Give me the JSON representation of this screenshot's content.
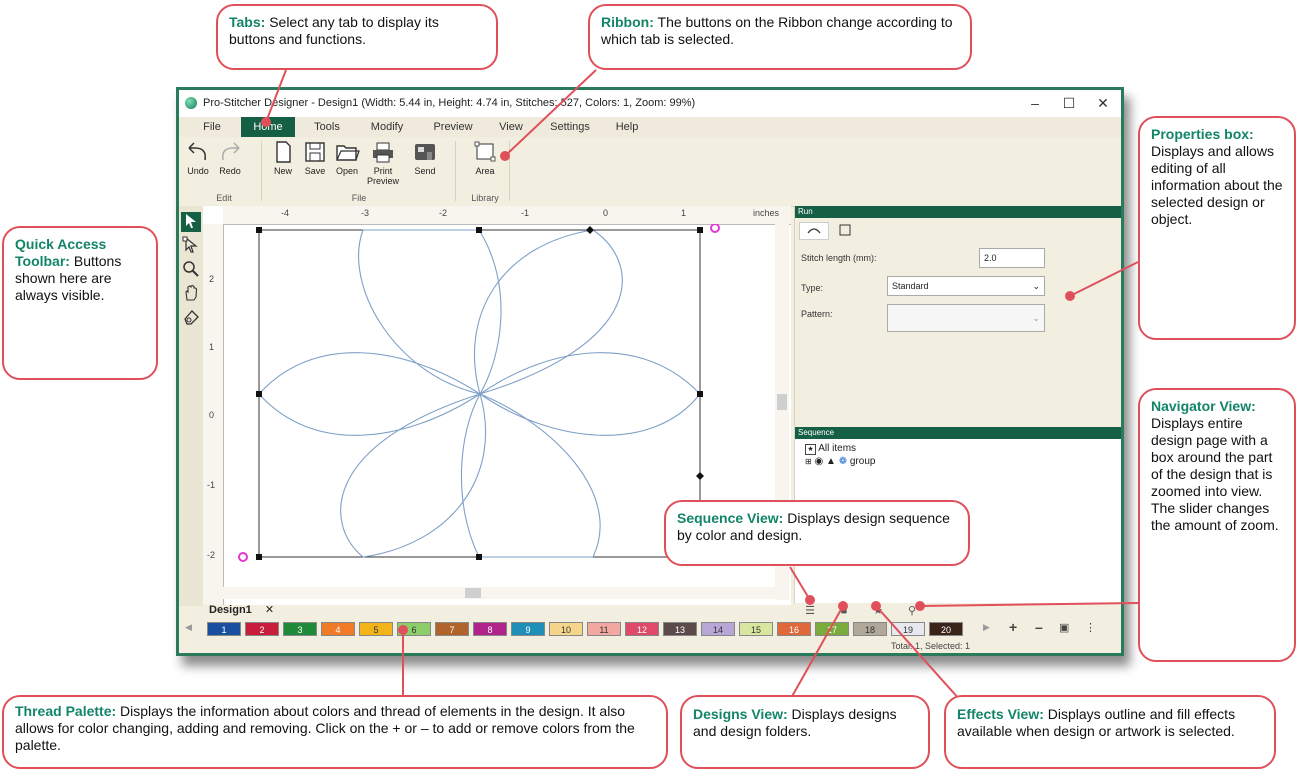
{
  "callouts": {
    "tabs": {
      "title": "Tabs:",
      "text": " Select any tab to display its buttons and functions."
    },
    "ribbon": {
      "title": "Ribbon:",
      "text": " The buttons on the Ribbon change according to which tab is selected."
    },
    "properties": {
      "title": "Properties box:",
      "text": " Displays and allows editing of all information about the selected design or object."
    },
    "qat": {
      "title": "Quick Access Toolbar:",
      "text": " Buttons shown here are always visible."
    },
    "navigator": {
      "title": "Navigator View:",
      "text": " Displays entire design page with a box around the part of the design that is zoomed into view. The slider changes the amount of zoom."
    },
    "sequence": {
      "title": "Sequence View:",
      "text": " Displays design sequence by color and design."
    },
    "palette": {
      "title": "Thread Palette:",
      "text": " Displays the information about colors and thread of elements in the design. It also allows for color changing, adding and removing. Click on the + or – to add or remove colors from the palette."
    },
    "designs": {
      "title": "Designs View:",
      "text": " Displays designs and design folders."
    },
    "effects": {
      "title": "Effects View:",
      "text": " Displays outline and fill effects available when design or artwork is selected."
    }
  },
  "window": {
    "title": "Pro-Stitcher Designer - Design1 (Width: 5.44 in, Height: 4.74 in, Stitches: 527, Colors: 1, Zoom: 99%)",
    "minimize": "–",
    "maximize": "☐",
    "close": "✕"
  },
  "tabs": [
    "File",
    "Home",
    "Tools",
    "Modify",
    "Preview",
    "View",
    "Settings",
    "Help"
  ],
  "active_tab": "Home",
  "ribbon": {
    "undo": "Undo",
    "redo": "Redo",
    "new": "New",
    "save": "Save",
    "open": "Open",
    "print_preview_1": "Print",
    "print_preview_2": "Preview",
    "send": "Send",
    "area": "Area",
    "group_edit": "Edit",
    "group_file": "File",
    "group_library": "Library"
  },
  "rulers": {
    "units": "inches",
    "h_ticks": [
      "-4",
      "-3",
      "-2",
      "-1",
      "0",
      "1"
    ],
    "v_ticks": [
      "2",
      "1",
      "0",
      "-1",
      "-2"
    ]
  },
  "document_tab": {
    "label": "Design1",
    "close": "✕"
  },
  "properties": {
    "header": "Run",
    "stitch_length_label": "Stitch length (mm):",
    "stitch_length_value": "2.0",
    "type_label": "Type:",
    "type_value": "Standard",
    "pattern_label": "Pattern:"
  },
  "sequence": {
    "header": "Sequence",
    "all_items": "All items",
    "group": "group"
  },
  "palette": {
    "colors": [
      {
        "label": "1",
        "color": "#1a4fa0"
      },
      {
        "label": "2",
        "color": "#c81e3c"
      },
      {
        "label": "3",
        "color": "#1f8a3a"
      },
      {
        "label": "4",
        "color": "#f07a28"
      },
      {
        "label": "5",
        "color": "#f2b418"
      },
      {
        "label": "6",
        "color": "#8ccf6a"
      },
      {
        "label": "7",
        "color": "#b0642c"
      },
      {
        "label": "8",
        "color": "#b0238a"
      },
      {
        "label": "9",
        "color": "#1f8fb8"
      },
      {
        "label": "10",
        "color": "#f4d58a"
      },
      {
        "label": "11",
        "color": "#f2a7a0"
      },
      {
        "label": "12",
        "color": "#e04a6a"
      },
      {
        "label": "13",
        "color": "#5a4a4a"
      },
      {
        "label": "14",
        "color": "#b8a7d6"
      },
      {
        "label": "15",
        "color": "#d8e6a0"
      },
      {
        "label": "16",
        "color": "#e0683a"
      },
      {
        "label": "17",
        "color": "#7aab3c"
      },
      {
        "label": "18",
        "color": "#b0a89a"
      },
      {
        "label": "19",
        "color": "#e8e8f0"
      },
      {
        "label": "20",
        "color": "#3a2318"
      }
    ]
  },
  "status": "Total: 1, Selected: 1",
  "accent": "#155f45",
  "callout_border": "#e0505a",
  "callout_title": "#138567"
}
